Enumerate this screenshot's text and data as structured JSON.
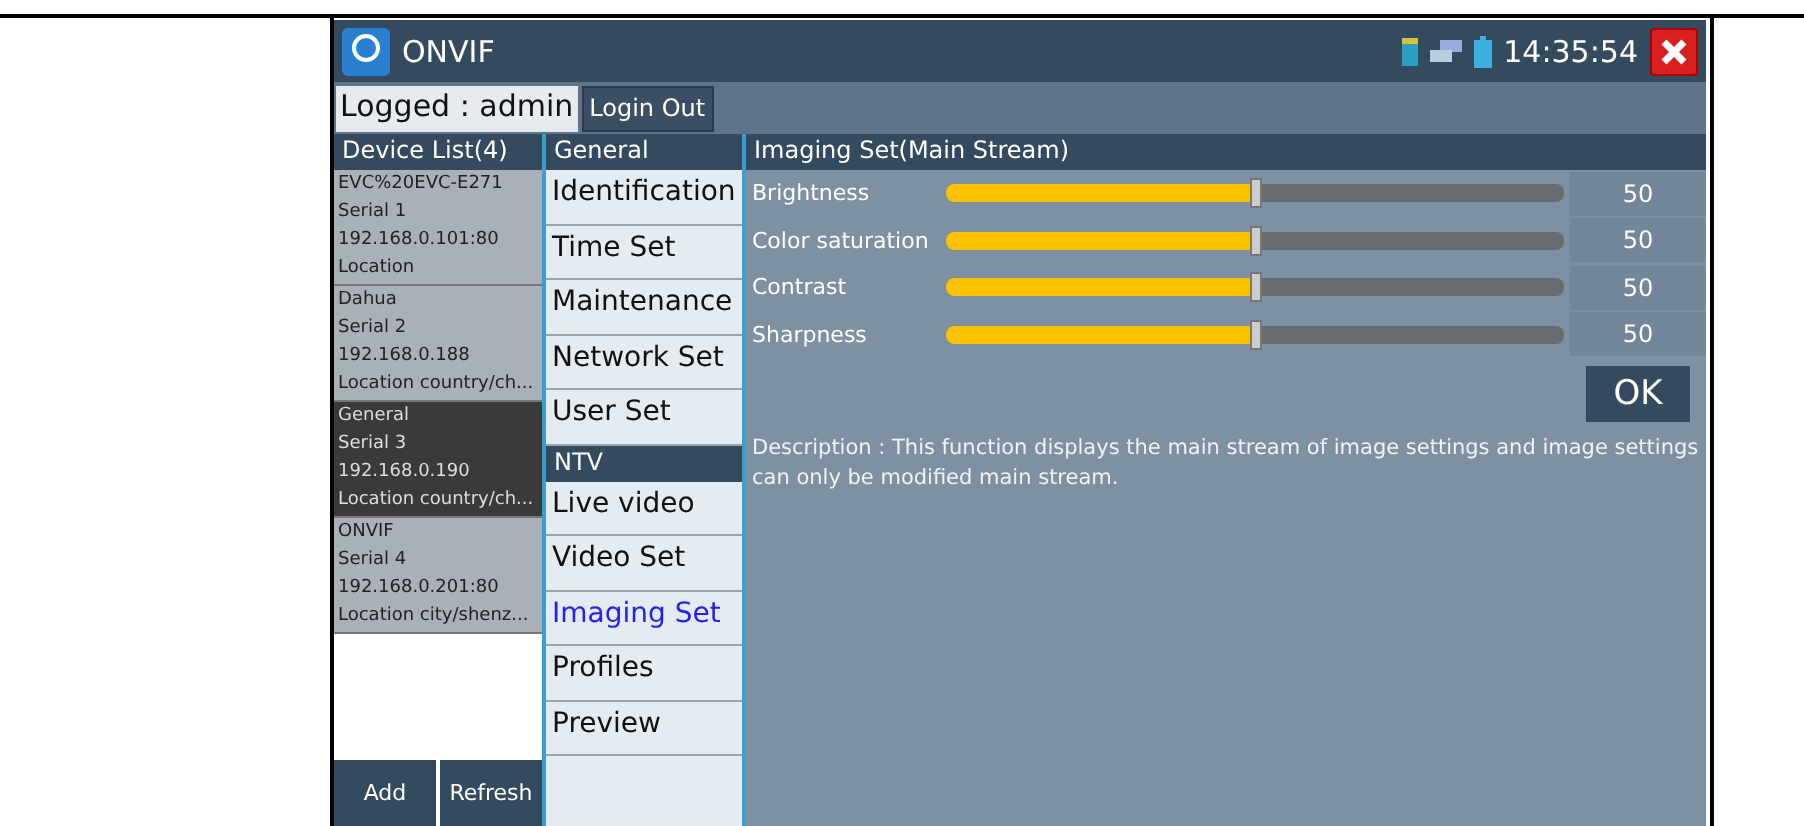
{
  "window": {
    "title": "ONVIF",
    "time": "14:35:54"
  },
  "login": {
    "status": "Logged : admin",
    "button": "Login Out"
  },
  "device_list": {
    "title": "Device List(4)",
    "devices": [
      {
        "lines": [
          "EVC%20EVC-E271",
          "Serial 1",
          "192.168.0.101:80",
          "Location"
        ],
        "selected": false
      },
      {
        "lines": [
          "Dahua",
          "Serial 2",
          "192.168.0.188",
          "Location country/ch..."
        ],
        "selected": false
      },
      {
        "lines": [
          "General",
          "Serial 3",
          "192.168.0.190",
          "Location country/ch..."
        ],
        "selected": true
      },
      {
        "lines": [
          "ONVIF",
          "Serial 4",
          "192.168.0.201:80",
          "Location city/shenz..."
        ],
        "selected": false
      }
    ],
    "buttons": [
      "Add",
      "Refresh"
    ]
  },
  "menu": [
    {
      "kind": "header",
      "label": "General"
    },
    {
      "kind": "item",
      "label": "Identification",
      "selected": false
    },
    {
      "kind": "item",
      "label": "Time Set",
      "selected": false
    },
    {
      "kind": "item",
      "label": "Maintenance",
      "selected": false
    },
    {
      "kind": "item",
      "label": "Network Set",
      "selected": false
    },
    {
      "kind": "item",
      "label": "User Set",
      "selected": false
    },
    {
      "kind": "header",
      "label": "NTV"
    },
    {
      "kind": "item",
      "label": "Live video",
      "selected": false
    },
    {
      "kind": "item",
      "label": "Video Set",
      "selected": false
    },
    {
      "kind": "item",
      "label": "Imaging Set",
      "selected": true
    },
    {
      "kind": "item",
      "label": "Profiles",
      "selected": false
    },
    {
      "kind": "item",
      "label": "Preview",
      "selected": false
    }
  ],
  "panel": {
    "title": "Imaging Set(Main Stream)",
    "sliders": [
      {
        "label": "Brightness",
        "level": 0.5,
        "value": "50"
      },
      {
        "label": "Color saturation",
        "level": 0.5,
        "value": "50"
      },
      {
        "label": "Contrast",
        "level": 0.5,
        "value": "50"
      },
      {
        "label": "Sharpness",
        "level": 0.5,
        "value": "50"
      }
    ],
    "ok_button": "OK",
    "description": "Description : This function displays the main stream of image settings and image settings can only be modified main stream."
  }
}
